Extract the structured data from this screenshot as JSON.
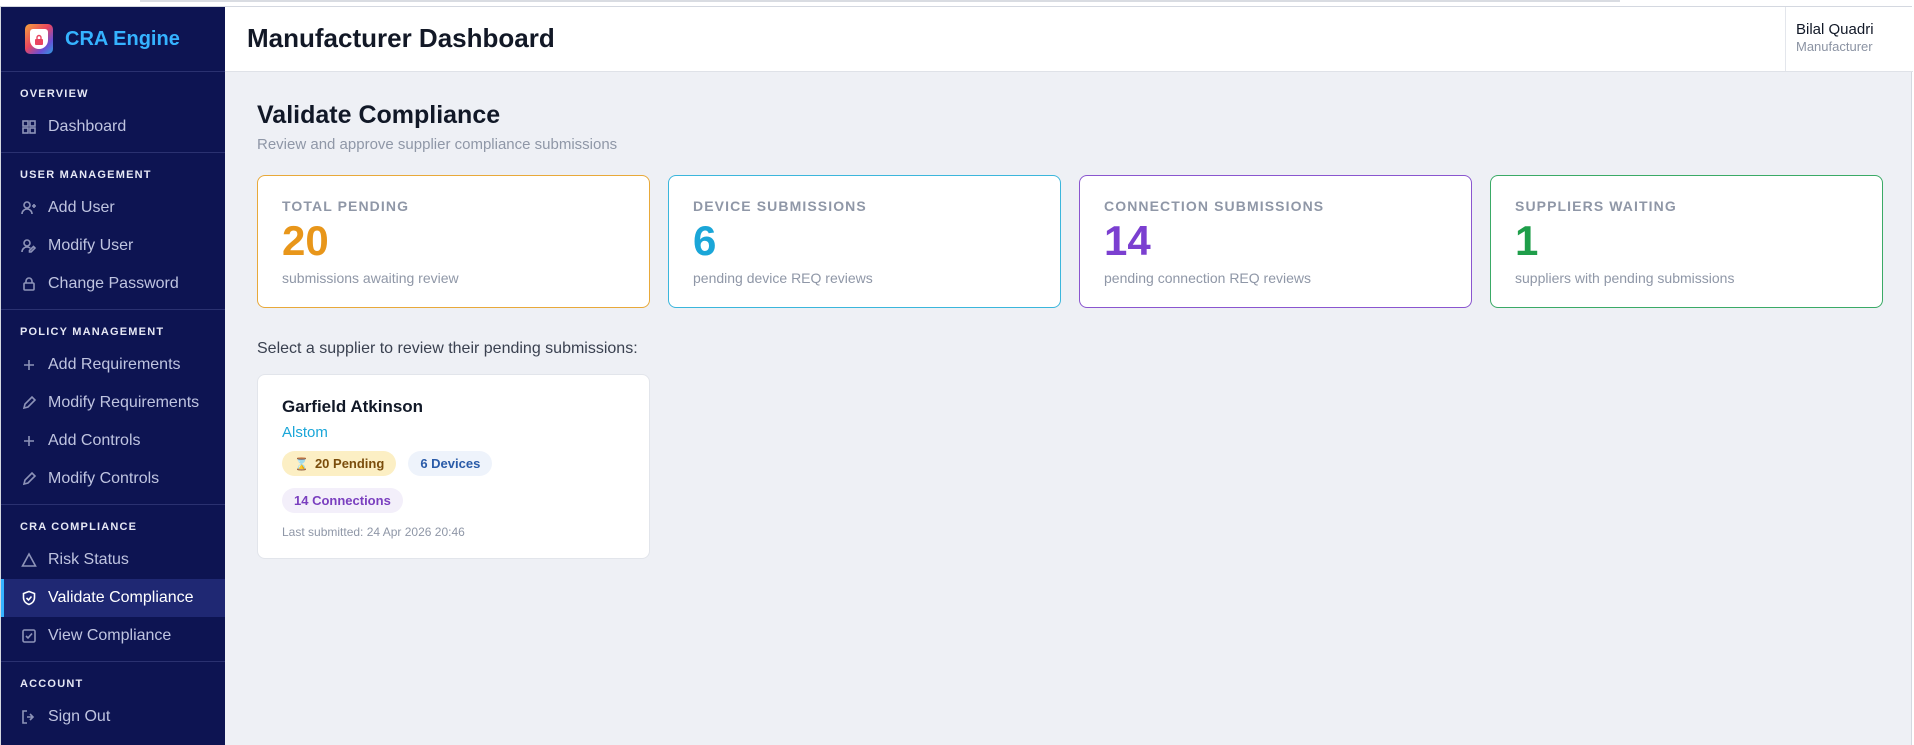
{
  "app": {
    "brand_name": "CRA Engine"
  },
  "header": {
    "title": "Manufacturer Dashboard",
    "user_name": "Bilal Quadri",
    "user_role": "Manufacturer"
  },
  "sidebar": {
    "sections": [
      {
        "title": "OVERVIEW",
        "items": [
          {
            "label": "Dashboard",
            "icon": "grid-icon"
          }
        ]
      },
      {
        "title": "USER MANAGEMENT",
        "items": [
          {
            "label": "Add User",
            "icon": "user-plus-icon"
          },
          {
            "label": "Modify User",
            "icon": "user-edit-icon"
          },
          {
            "label": "Change Password",
            "icon": "lock-icon"
          }
        ]
      },
      {
        "title": "POLICY MANAGEMENT",
        "items": [
          {
            "label": "Add Requirements",
            "icon": "plus-icon"
          },
          {
            "label": "Modify Requirements",
            "icon": "pencil-icon"
          },
          {
            "label": "Add Controls",
            "icon": "plus-icon"
          },
          {
            "label": "Modify Controls",
            "icon": "pencil-icon"
          }
        ]
      },
      {
        "title": "CRA COMPLIANCE",
        "items": [
          {
            "label": "Risk Status",
            "icon": "warning-triangle-icon"
          },
          {
            "label": "Validate Compliance",
            "icon": "shield-check-icon",
            "active": true
          },
          {
            "label": "View Compliance",
            "icon": "checkbox-icon"
          }
        ]
      },
      {
        "title": "ACCOUNT",
        "items": [
          {
            "label": "Sign Out",
            "icon": "sign-out-icon"
          }
        ]
      }
    ]
  },
  "main": {
    "title": "Validate Compliance",
    "subtitle": "Review and approve supplier compliance submissions",
    "stats": [
      {
        "label": "TOTAL PENDING",
        "value": "20",
        "desc": "submissions awaiting review",
        "color": "#e8961a"
      },
      {
        "label": "DEVICE SUBMISSIONS",
        "value": "6",
        "desc": "pending device REQ reviews",
        "color": "#1aa6d8"
      },
      {
        "label": "CONNECTION SUBMISSIONS",
        "value": "14",
        "desc": "pending connection REQ reviews",
        "color": "#7b3fd0"
      },
      {
        "label": "SUPPLIERS WAITING",
        "value": "1",
        "desc": "suppliers with pending submissions",
        "color": "#1f9e4a"
      }
    ],
    "prompt": "Select a supplier to review their pending submissions:",
    "supplier": {
      "name": "Garfield Atkinson",
      "company": "Alstom",
      "pending_badge": "20 Pending",
      "devices_badge": "6 Devices",
      "connections_badge": "14 Connections",
      "last_submitted": "Last submitted: 24 Apr 2026 20:46"
    }
  }
}
